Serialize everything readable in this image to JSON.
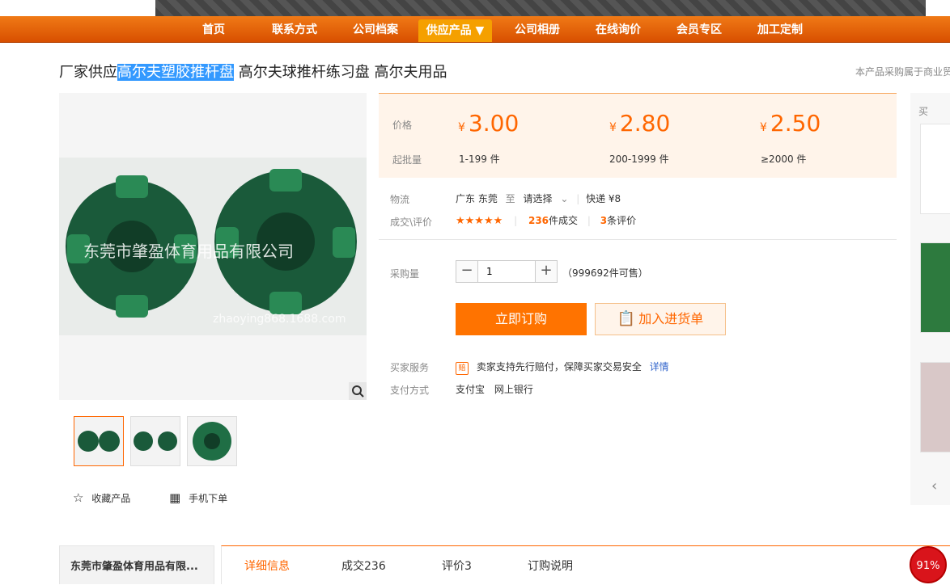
{
  "nav": {
    "items": [
      {
        "label": "首页"
      },
      {
        "label": "联系方式"
      },
      {
        "label": "公司档案"
      },
      {
        "label": "供应产品 ▼"
      },
      {
        "label": "公司相册"
      },
      {
        "label": "在线询价"
      },
      {
        "label": "会员专区"
      },
      {
        "label": "加工定制"
      }
    ]
  },
  "product": {
    "title_pre": "厂家供应",
    "title_hl": "高尔夫塑胶推杆盘",
    "title_post": " 高尔夫球推杆练习盘 高尔夫用品",
    "notice": "本产品采购属于商业贸"
  },
  "gallery": {
    "watermark": "东莞市肇盈体育用品有限公司",
    "watermark_url": "zhaoying868.1688.com"
  },
  "pricing": {
    "price_label": "价格",
    "moq_label": "起批量",
    "currency": "¥",
    "tiers": [
      {
        "price": "3.00",
        "qty": "1-199 件"
      },
      {
        "price": "2.80",
        "qty": "200-1999 件"
      },
      {
        "price": "2.50",
        "qty": "≥2000 件"
      }
    ]
  },
  "logistics": {
    "label": "物流",
    "from": "广东 东莞",
    "to_word": "至",
    "select": "请选择",
    "express": "快递 ¥8"
  },
  "deals": {
    "label": "成交\\评价",
    "stars": "★★★★★",
    "deal_count": "236",
    "deal_suffix": "件成交",
    "review_count": "3",
    "review_suffix": "条评价"
  },
  "purchase": {
    "label": "采购量",
    "quantity": "1",
    "available": "（999692件可售）",
    "buy_now": "立即订购",
    "add_cart": "加入进货单"
  },
  "service": {
    "label": "买家服务",
    "text": "卖家支持先行赔付，保障买家交易安全",
    "link": "详情",
    "pay_label": "支付方式",
    "pay_methods": [
      "支付宝",
      "网上银行"
    ]
  },
  "left_actions": {
    "favorite": "收藏产品",
    "mobile": "手机下单"
  },
  "sidebar": {
    "title": "买"
  },
  "company": {
    "name": "东莞市肇盈体育用品有限..."
  },
  "tabs": [
    {
      "label": "详细信息"
    },
    {
      "label": "成交236"
    },
    {
      "label": "评价3"
    },
    {
      "label": "订购说明"
    }
  ],
  "badge": {
    "percent": "91%"
  },
  "colors": {
    "accent": "#ff6600",
    "nav": "#e86410",
    "active_nav": "#f5a000"
  }
}
